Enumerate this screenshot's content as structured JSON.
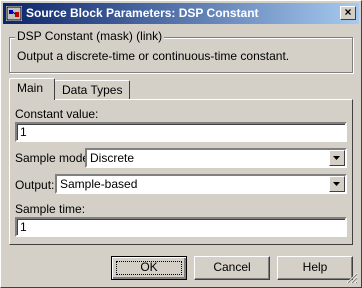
{
  "window": {
    "title": "Source Block Parameters: DSP Constant",
    "close_label": "×"
  },
  "group": {
    "legend": "DSP Constant (mask) (link)",
    "description": "Output a discrete-time or continuous-time constant."
  },
  "tabs": [
    {
      "label": "Main",
      "active": true
    },
    {
      "label": "Data Types",
      "active": false
    }
  ],
  "params": {
    "constant_label": "Constant value:",
    "constant_value": "1",
    "sample_mode_label": "Sample mode:",
    "sample_mode_value": "Discrete",
    "output_label": "Output:",
    "output_value": "Sample-based",
    "sample_time_label": "Sample time:",
    "sample_time_value": "1"
  },
  "buttons": {
    "ok": "OK",
    "cancel": "Cancel",
    "help": "Help"
  },
  "colors": {
    "title_start": "#0a246a",
    "title_end": "#a6caf0",
    "face": "#d4d0c8"
  }
}
